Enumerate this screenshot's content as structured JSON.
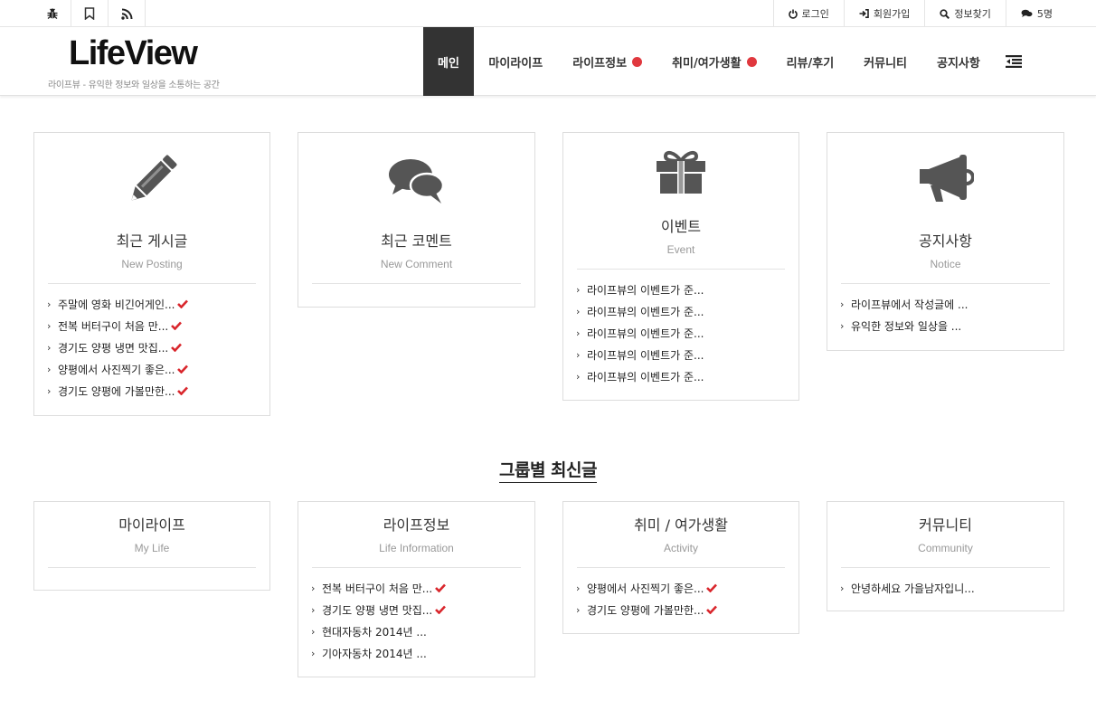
{
  "topbar": {
    "icons": [
      "bug-icon",
      "bookmark-icon",
      "rss-icon"
    ],
    "links": [
      {
        "label": "로그인",
        "icon": "power-icon"
      },
      {
        "label": "회원가입",
        "icon": "sign-in-icon"
      },
      {
        "label": "정보찾기",
        "icon": "search-icon"
      },
      {
        "label": "5명",
        "icon": "comments-icon"
      }
    ]
  },
  "header": {
    "logo": "LifeView",
    "slogan": "라이프뷰 - 유익한 정보와 일상을 소통하는 공간",
    "nav": [
      {
        "label": "메인",
        "active": true
      },
      {
        "label": "마이라이프"
      },
      {
        "label": "라이프정보",
        "new_dot": true
      },
      {
        "label": "취미/여가생활",
        "new_dot": true
      },
      {
        "label": "리뷰/후기"
      },
      {
        "label": "커뮤니티"
      },
      {
        "label": "공지사항"
      }
    ],
    "accent": "#e0383e"
  },
  "top_cards": [
    {
      "icon": "pencil-icon",
      "title": "최근 게시글",
      "subtitle": "New Posting",
      "items": [
        "주말에 영화 비긴어게인...",
        "전복 버터구이 처음 만...",
        "경기도 양평 냉면 맛집...",
        "양평에서 사진찍기 좋은...",
        "경기도 양평에 가볼만한..."
      ]
    },
    {
      "icon": "comments-icon",
      "title": "최근 코멘트",
      "subtitle": "New Comment",
      "items": []
    },
    {
      "icon": "gift-icon",
      "title": "이벤트",
      "subtitle": "Event",
      "items": [
        "라이프뷰의 이벤트가 준...",
        "라이프뷰의 이벤트가 준...",
        "라이프뷰의 이벤트가 준...",
        "라이프뷰의 이벤트가 준...",
        "라이프뷰의 이벤트가 준..."
      ]
    },
    {
      "icon": "bullhorn-icon",
      "title": "공지사항",
      "subtitle": "Notice",
      "items": [
        "라이프뷰에서 작성글에 ...",
        "유익한 정보와 일상을 ..."
      ]
    }
  ],
  "section_title": "그룹별 최신글",
  "group_cards": [
    {
      "title": "마이라이프",
      "subtitle": "My Life",
      "items": []
    },
    {
      "title": "라이프정보",
      "subtitle": "Life Information",
      "items": [
        "전복 버터구이 처음 만...",
        "경기도 양평 냉면 맛집...",
        "현대자동차 2014년 ...",
        "기아자동차 2014년 ..."
      ]
    },
    {
      "title": "취미 / 여가생활",
      "subtitle": "Activity",
      "items": [
        "양평에서 사진찍기 좋은...",
        "경기도 양평에 가볼만한..."
      ]
    },
    {
      "title": "커뮤니티",
      "subtitle": "Community",
      "items": [
        "안녕하세요 가을남자입니..."
      ]
    }
  ]
}
